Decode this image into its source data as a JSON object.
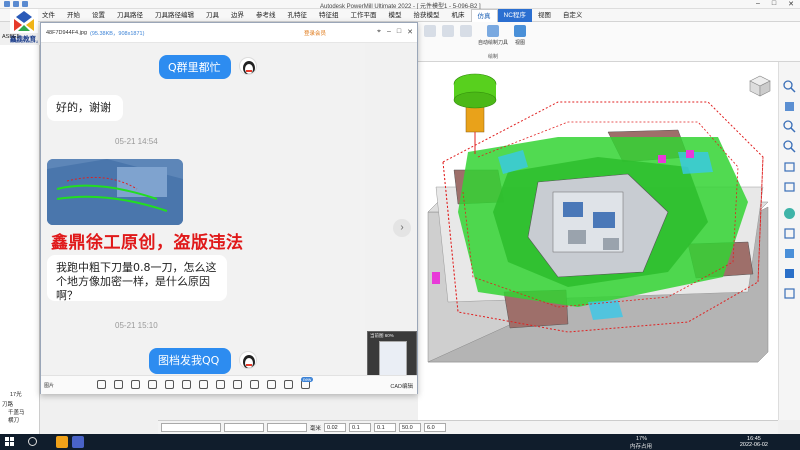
{
  "app": {
    "title": "Autodesk PowerMill Ultimate 2022 - [ 元件模型1 - 5-096-B2 ]",
    "menu_tabs": [
      "文件",
      "开始",
      "设置",
      "刀具路径",
      "刀具路径编辑",
      "刀具",
      "边界",
      "参考线",
      "孔特征",
      "特征组",
      "工作平面",
      "模型",
      "拾获模型",
      "机床",
      "仿真",
      "NC程序",
      "视图",
      "自定义"
    ],
    "active_tab_index": 14,
    "ribbon": {
      "button1": "自动绘制刀具",
      "button2": "视图",
      "group_caption": "绘制"
    }
  },
  "logo": {
    "name": "鑫鼎教育",
    "pinyin": "XINDING JIAOYU"
  },
  "tree": {
    "items": [
      "ASBE5",
      "17光",
      "刀路",
      "千盖马",
      "横刀"
    ]
  },
  "viewer": {
    "filename": "48F7D944F4.jpg",
    "filesize": "(95.38KB，908x1871)",
    "vip_label": "登录会员",
    "thumbnail_caption": "当前图 60%",
    "footer_label": "图片",
    "cad_label": "CAD编辑",
    "new_badge": "new"
  },
  "chat": {
    "messages": [
      {
        "side": "right",
        "text": "Q群里都忙"
      },
      {
        "side": "left",
        "text": "好的，谢谢"
      },
      {
        "time": "05-21 14:54"
      },
      {
        "side": "left",
        "type": "image"
      },
      {
        "side": "left",
        "text": "我跑中粗下刀量0.8一刀，怎么这个地方像加密一样，是什么原因啊？"
      },
      {
        "time": "05-21 15:10"
      },
      {
        "side": "right",
        "text": "图档发我QQ"
      }
    ],
    "watermark": "鑫鼎徐工原创，盗版违法"
  },
  "bottom_toolbar": {
    "unit": "毫米",
    "v1": "0.02",
    "v2": "0.1",
    "v3": "0.1",
    "v4": "50.0",
    "v5": "6.0"
  },
  "taskbar": {
    "cpu": "17%",
    "cpu_label": "内存占用",
    "time": "16:45",
    "date": "2022-06-02"
  },
  "colors": {
    "accent": "#2d8cf0",
    "toolpath_green": "#22cc22",
    "toolpath_red": "#e02020",
    "watermark": "#e0191a",
    "block_gray": "#c8c8c8",
    "block_brown": "#9e6f6a"
  }
}
